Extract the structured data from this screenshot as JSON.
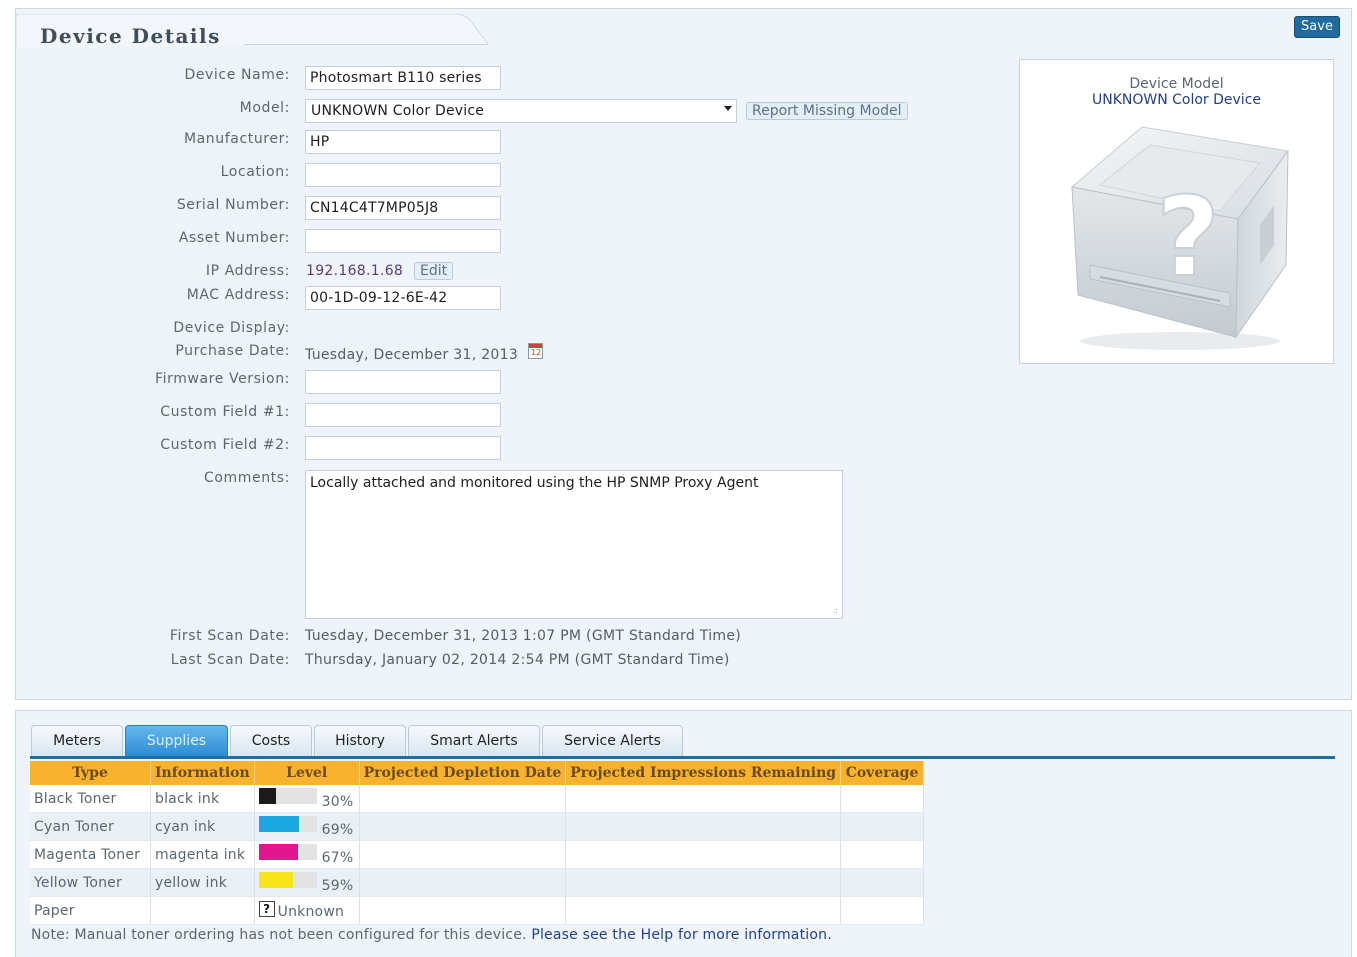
{
  "header": {
    "title": "Device Details",
    "save_label": "Save"
  },
  "form": {
    "device_name": {
      "label": "Device Name:",
      "value": "Photosmart B110 series"
    },
    "model": {
      "label": "Model:",
      "value": "UNKNOWN Color Device",
      "report_button": "Report Missing Model"
    },
    "manufacturer": {
      "label": "Manufacturer:",
      "value": "HP"
    },
    "location": {
      "label": "Location:",
      "value": ""
    },
    "serial": {
      "label": "Serial Number:",
      "value": "CN14C4T7MP05J8"
    },
    "asset": {
      "label": "Asset Number:",
      "value": ""
    },
    "ip": {
      "label": "IP Address:",
      "value": "192.168.1.68",
      "edit_label": "Edit"
    },
    "mac": {
      "label": "MAC Address:",
      "value": "00-1D-09-12-6E-42"
    },
    "display": {
      "label": "Device Display:"
    },
    "purchase": {
      "label": "Purchase Date:",
      "value": "Tuesday, December 31, 2013",
      "calendar_icon": "calendar-icon",
      "calendar_day": "12"
    },
    "firmware": {
      "label": "Firmware Version:",
      "value": ""
    },
    "custom1": {
      "label": "Custom Field #1:",
      "value": ""
    },
    "custom2": {
      "label": "Custom Field #2:",
      "value": ""
    },
    "comments": {
      "label": "Comments:",
      "value": "Locally attached and monitored using the HP SNMP Proxy Agent"
    },
    "first_scan": {
      "label": "First Scan Date:",
      "value": "Tuesday, December 31, 2013 1:07 PM (GMT Standard Time)"
    },
    "last_scan": {
      "label": "Last Scan Date:",
      "value": "Thursday, January 02, 2014 2:54 PM (GMT Standard Time)"
    }
  },
  "model_card": {
    "label": "Device Model",
    "name": "UNKNOWN Color Device",
    "image": "unknown-printer-image"
  },
  "tabs": [
    {
      "label": "Meters"
    },
    {
      "label": "Supplies",
      "active": true
    },
    {
      "label": "Costs"
    },
    {
      "label": "History"
    },
    {
      "label": "Smart Alerts"
    },
    {
      "label": "Service Alerts"
    }
  ],
  "supplies": {
    "columns": [
      "Type",
      "Information",
      "Level",
      "Projected Depletion Date",
      "Projected Impressions Remaining",
      "Coverage"
    ],
    "rows": [
      {
        "type": "Black Toner",
        "info": "black ink",
        "level": "30%",
        "fraction": 0.3,
        "color": "#1a1a1a"
      },
      {
        "type": "Cyan Toner",
        "info": "cyan ink",
        "level": "69%",
        "fraction": 0.69,
        "color": "#1aa7e0"
      },
      {
        "type": "Magenta Toner",
        "info": "magenta ink",
        "level": "67%",
        "fraction": 0.67,
        "color": "#e0178f"
      },
      {
        "type": "Yellow Toner",
        "info": "yellow ink",
        "level": "59%",
        "fraction": 0.59,
        "color": "#f6e51a"
      },
      {
        "type": "Paper",
        "info": "",
        "level": "Unknown",
        "unknown": true,
        "icon": "question-icon",
        "icon_glyph": "?"
      }
    ]
  },
  "note": {
    "text": "Note: Manual toner ordering has not been configured for this device.",
    "link": "Please see the Help for more information."
  }
}
